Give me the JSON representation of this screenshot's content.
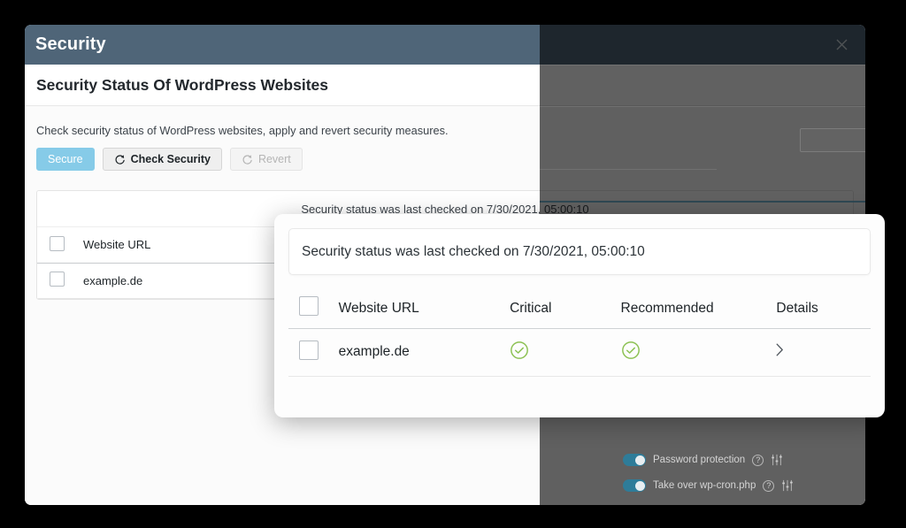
{
  "window": {
    "title": "Security",
    "close_icon": "close-icon",
    "page_title": "Security Status Of WordPress Websites",
    "intro": "Check security status of WordPress websites, apply and revert security measures.",
    "toolbar": {
      "secure_label": "Secure",
      "check_security_label": "Check Security",
      "check_security_icon": "refresh-icon",
      "revert_label": "Revert",
      "revert_icon": "refresh-icon"
    },
    "table_card": {
      "banner_text": "Security status was last checked on 7/30/2021, 05:00:10",
      "columns": [
        "Website URL"
      ],
      "rows": [
        {
          "url": "example.de"
        }
      ]
    }
  },
  "popup": {
    "banner_text": "Security status was last checked on 7/30/2021, 05:00:10",
    "columns": {
      "select_all": "",
      "url": "Website URL",
      "critical": "Critical",
      "recommended": "Recommended",
      "details": "Details"
    },
    "rows": [
      {
        "url": "example.de",
        "critical_status": "ok",
        "recommended_status": "ok",
        "details_icon": "chevron-right-icon"
      }
    ],
    "status_color_ok": "#8cc152"
  },
  "background_panel": {
    "toggles": [
      {
        "label": "Password protection",
        "state": "on",
        "help_icon": "question-mark-icon",
        "settings_icon": "sliders-icon"
      },
      {
        "label": "Take over wp-cron.php",
        "state": "on",
        "help_icon": "question-mark-icon",
        "settings_icon": "sliders-icon"
      }
    ]
  },
  "colors": {
    "titlebar": "#4f6578",
    "primary_button": "#86cbe8",
    "status_ok": "#8cc152",
    "accent_line": "#2c4752"
  }
}
